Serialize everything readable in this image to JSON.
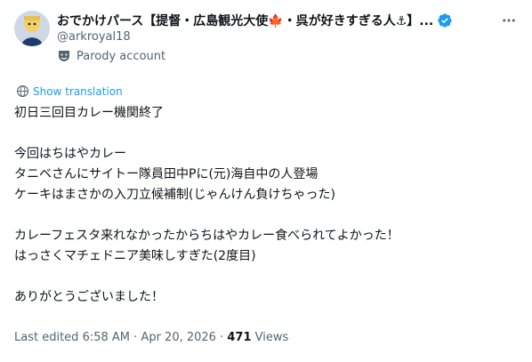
{
  "author": {
    "display_name": "おでかけパース【提督・広島観光大使🍁・呉が好きすぎる人⚓】...",
    "handle": "@arkroyal18",
    "account_label": "Parody account",
    "verified_color": "#1d9bf0"
  },
  "translate_label": "Show translation",
  "tweet_lines": [
    "初日三回目カレー機関終了",
    "",
    "今回はちはやカレー",
    "タニベさんにサイトー隊員田中Pに(元)海自中の人登場",
    "ケーキはまさかの入刀立候補制(じゃんけん負けちゃった)",
    "",
    "カレーフェスタ来れなかったからちはやカレー食べられてよかった！",
    "はっさくマチェドニア美味しすぎた(2度目)",
    "",
    "ありがとうございました！"
  ],
  "meta": {
    "edited_label": "Last edited",
    "time": "6:58 AM",
    "separator": "·",
    "date": "Apr 20, 2026",
    "views_count": "471",
    "views_label": "Views"
  },
  "icons": {
    "verified": "verified-badge-icon",
    "more": "more-options-icon",
    "parody": "theater-mask-icon",
    "translate": "globe-icon"
  }
}
